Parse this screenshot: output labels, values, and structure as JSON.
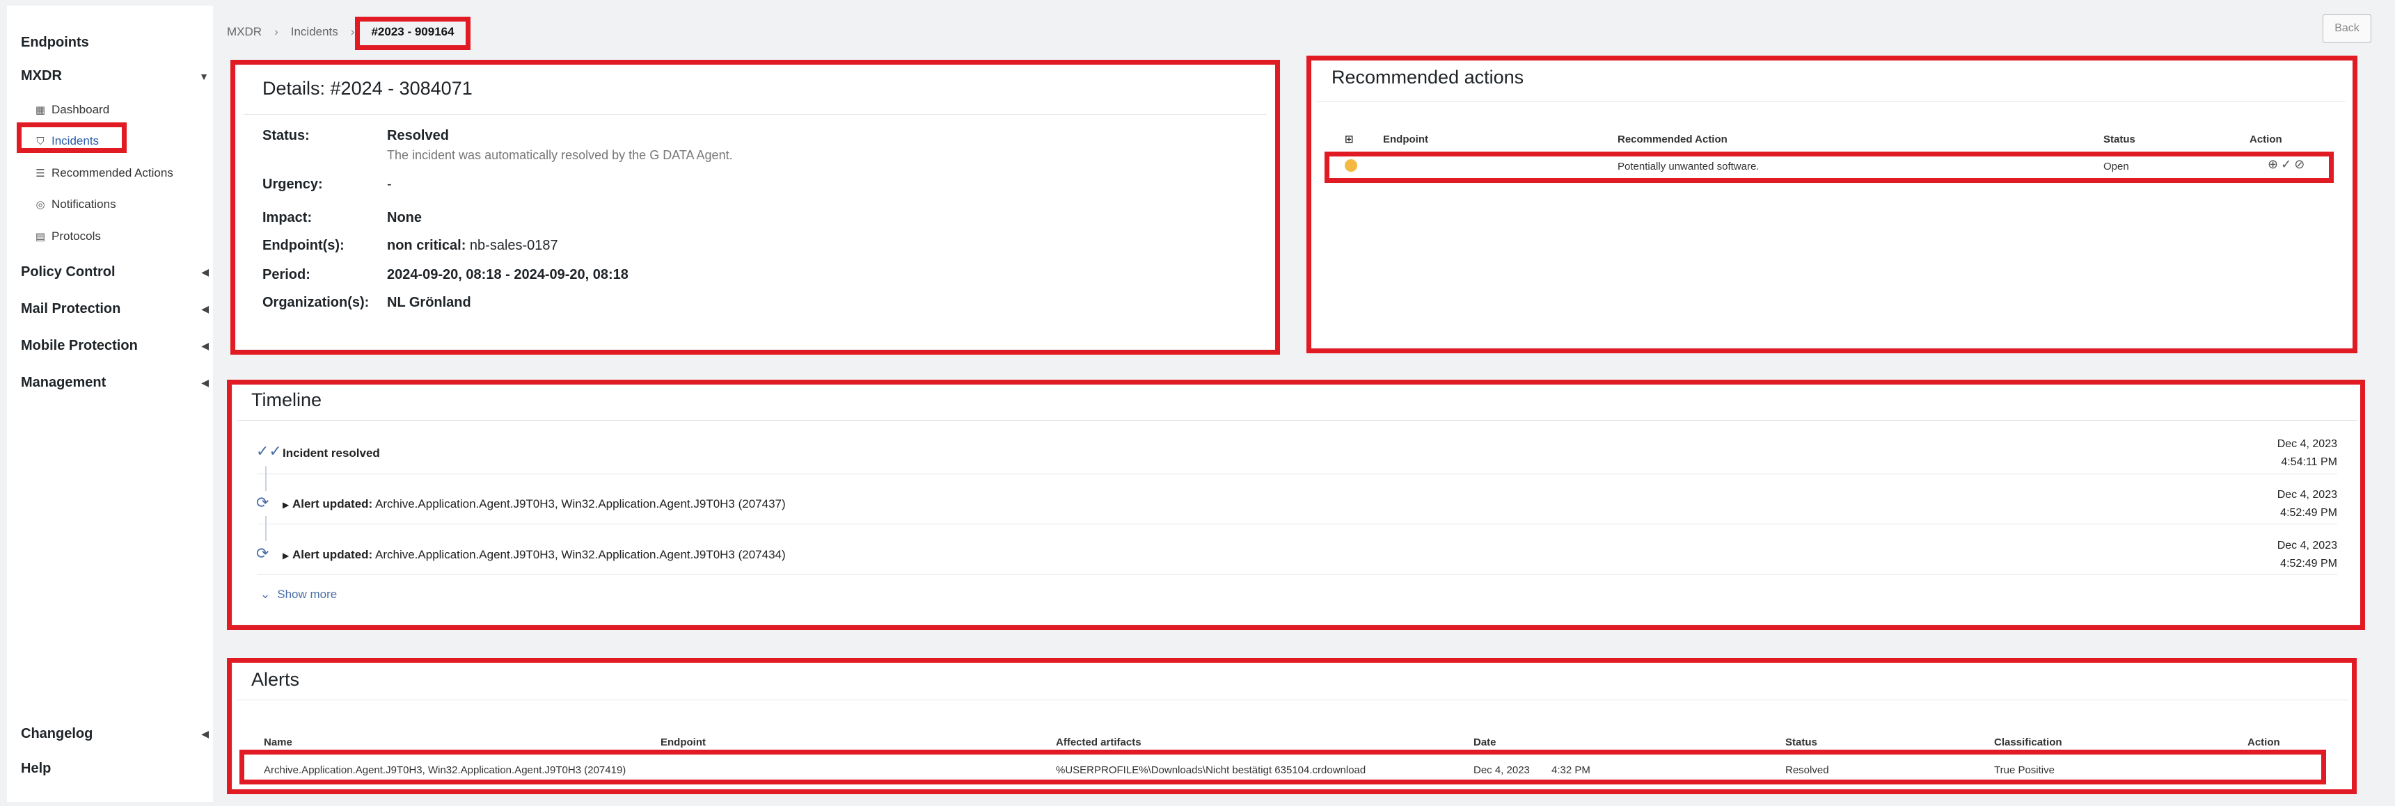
{
  "sidebar": {
    "top_item": "Endpoints",
    "mxdr": {
      "label": "MXDR",
      "items": [
        {
          "label": "Dashboard",
          "icon": "grid-icon"
        },
        {
          "label": "Incidents",
          "icon": "shield-icon"
        },
        {
          "label": "Recommended Actions",
          "icon": "list-icon"
        },
        {
          "label": "Notifications",
          "icon": "bell-icon"
        },
        {
          "label": "Protocols",
          "icon": "document-icon"
        }
      ]
    },
    "sections": [
      "Policy Control",
      "Mail Protection",
      "Mobile Protection",
      "Management"
    ],
    "bottom": [
      "Changelog",
      "Help"
    ]
  },
  "breadcrumb": {
    "items": [
      "MXDR",
      "Incidents"
    ],
    "current": "#2023 - 909164"
  },
  "back_label": "Back",
  "details": {
    "title": "Details: #2024 - 3084071",
    "status_label": "Status:",
    "status_value": "Resolved",
    "status_sub": "The incident was automatically resolved by the G DATA Agent.",
    "urgency_label": "Urgency:",
    "urgency_value": "-",
    "impact_label": "Impact:",
    "impact_value": "None",
    "endpoints_label": "Endpoint(s):",
    "endpoints_prefix": "non critical:",
    "endpoints_value": "nb-sales-0187",
    "period_label": "Period:",
    "period_value": "2024-09-20, 08:18 - 2024-09-20, 08:18",
    "org_label": "Organization(s):",
    "org_value": "NL Grönland"
  },
  "recommended": {
    "title": "Recommended actions",
    "headers": [
      "Endpoint",
      "Recommended Action",
      "Status",
      "Action"
    ],
    "row": {
      "endpoint": "",
      "action": "Potentially unwanted software.",
      "status": "Open",
      "status_color": "#f5b942"
    }
  },
  "timeline": {
    "title": "Timeline",
    "events": [
      {
        "label": "Incident resolved",
        "detail": "",
        "date": "Dec 4, 2023",
        "time": "4:54:11 PM",
        "icon": "double-check-icon"
      },
      {
        "label": "Alert updated:",
        "detail": "Archive.Application.Agent.J9T0H3, Win32.Application.Agent.J9T0H3 (207437)",
        "date": "Dec 4, 2023",
        "time": "4:52:49 PM",
        "icon": "refresh-icon"
      },
      {
        "label": "Alert updated:",
        "detail": "Archive.Application.Agent.J9T0H3, Win32.Application.Agent.J9T0H3 (207434)",
        "date": "Dec 4, 2023",
        "time": "4:52:49 PM",
        "icon": "refresh-icon"
      }
    ],
    "show_more": "Show more"
  },
  "alerts": {
    "title": "Alerts",
    "headers": [
      "Name",
      "Endpoint",
      "Affected artifacts",
      "Date",
      "Status",
      "Classification",
      "Action"
    ],
    "row": {
      "name": "Archive.Application.Agent.J9T0H3, Win32.Application.Agent.J9T0H3 (207419)",
      "endpoint": "",
      "artifacts": "%USERPROFILE%\\Downloads\\Nicht bestätigt 635104.crdownload",
      "date": "Dec 4, 2023",
      "time": "4:32 PM",
      "status": "Resolved",
      "classification": "True Positive"
    }
  }
}
